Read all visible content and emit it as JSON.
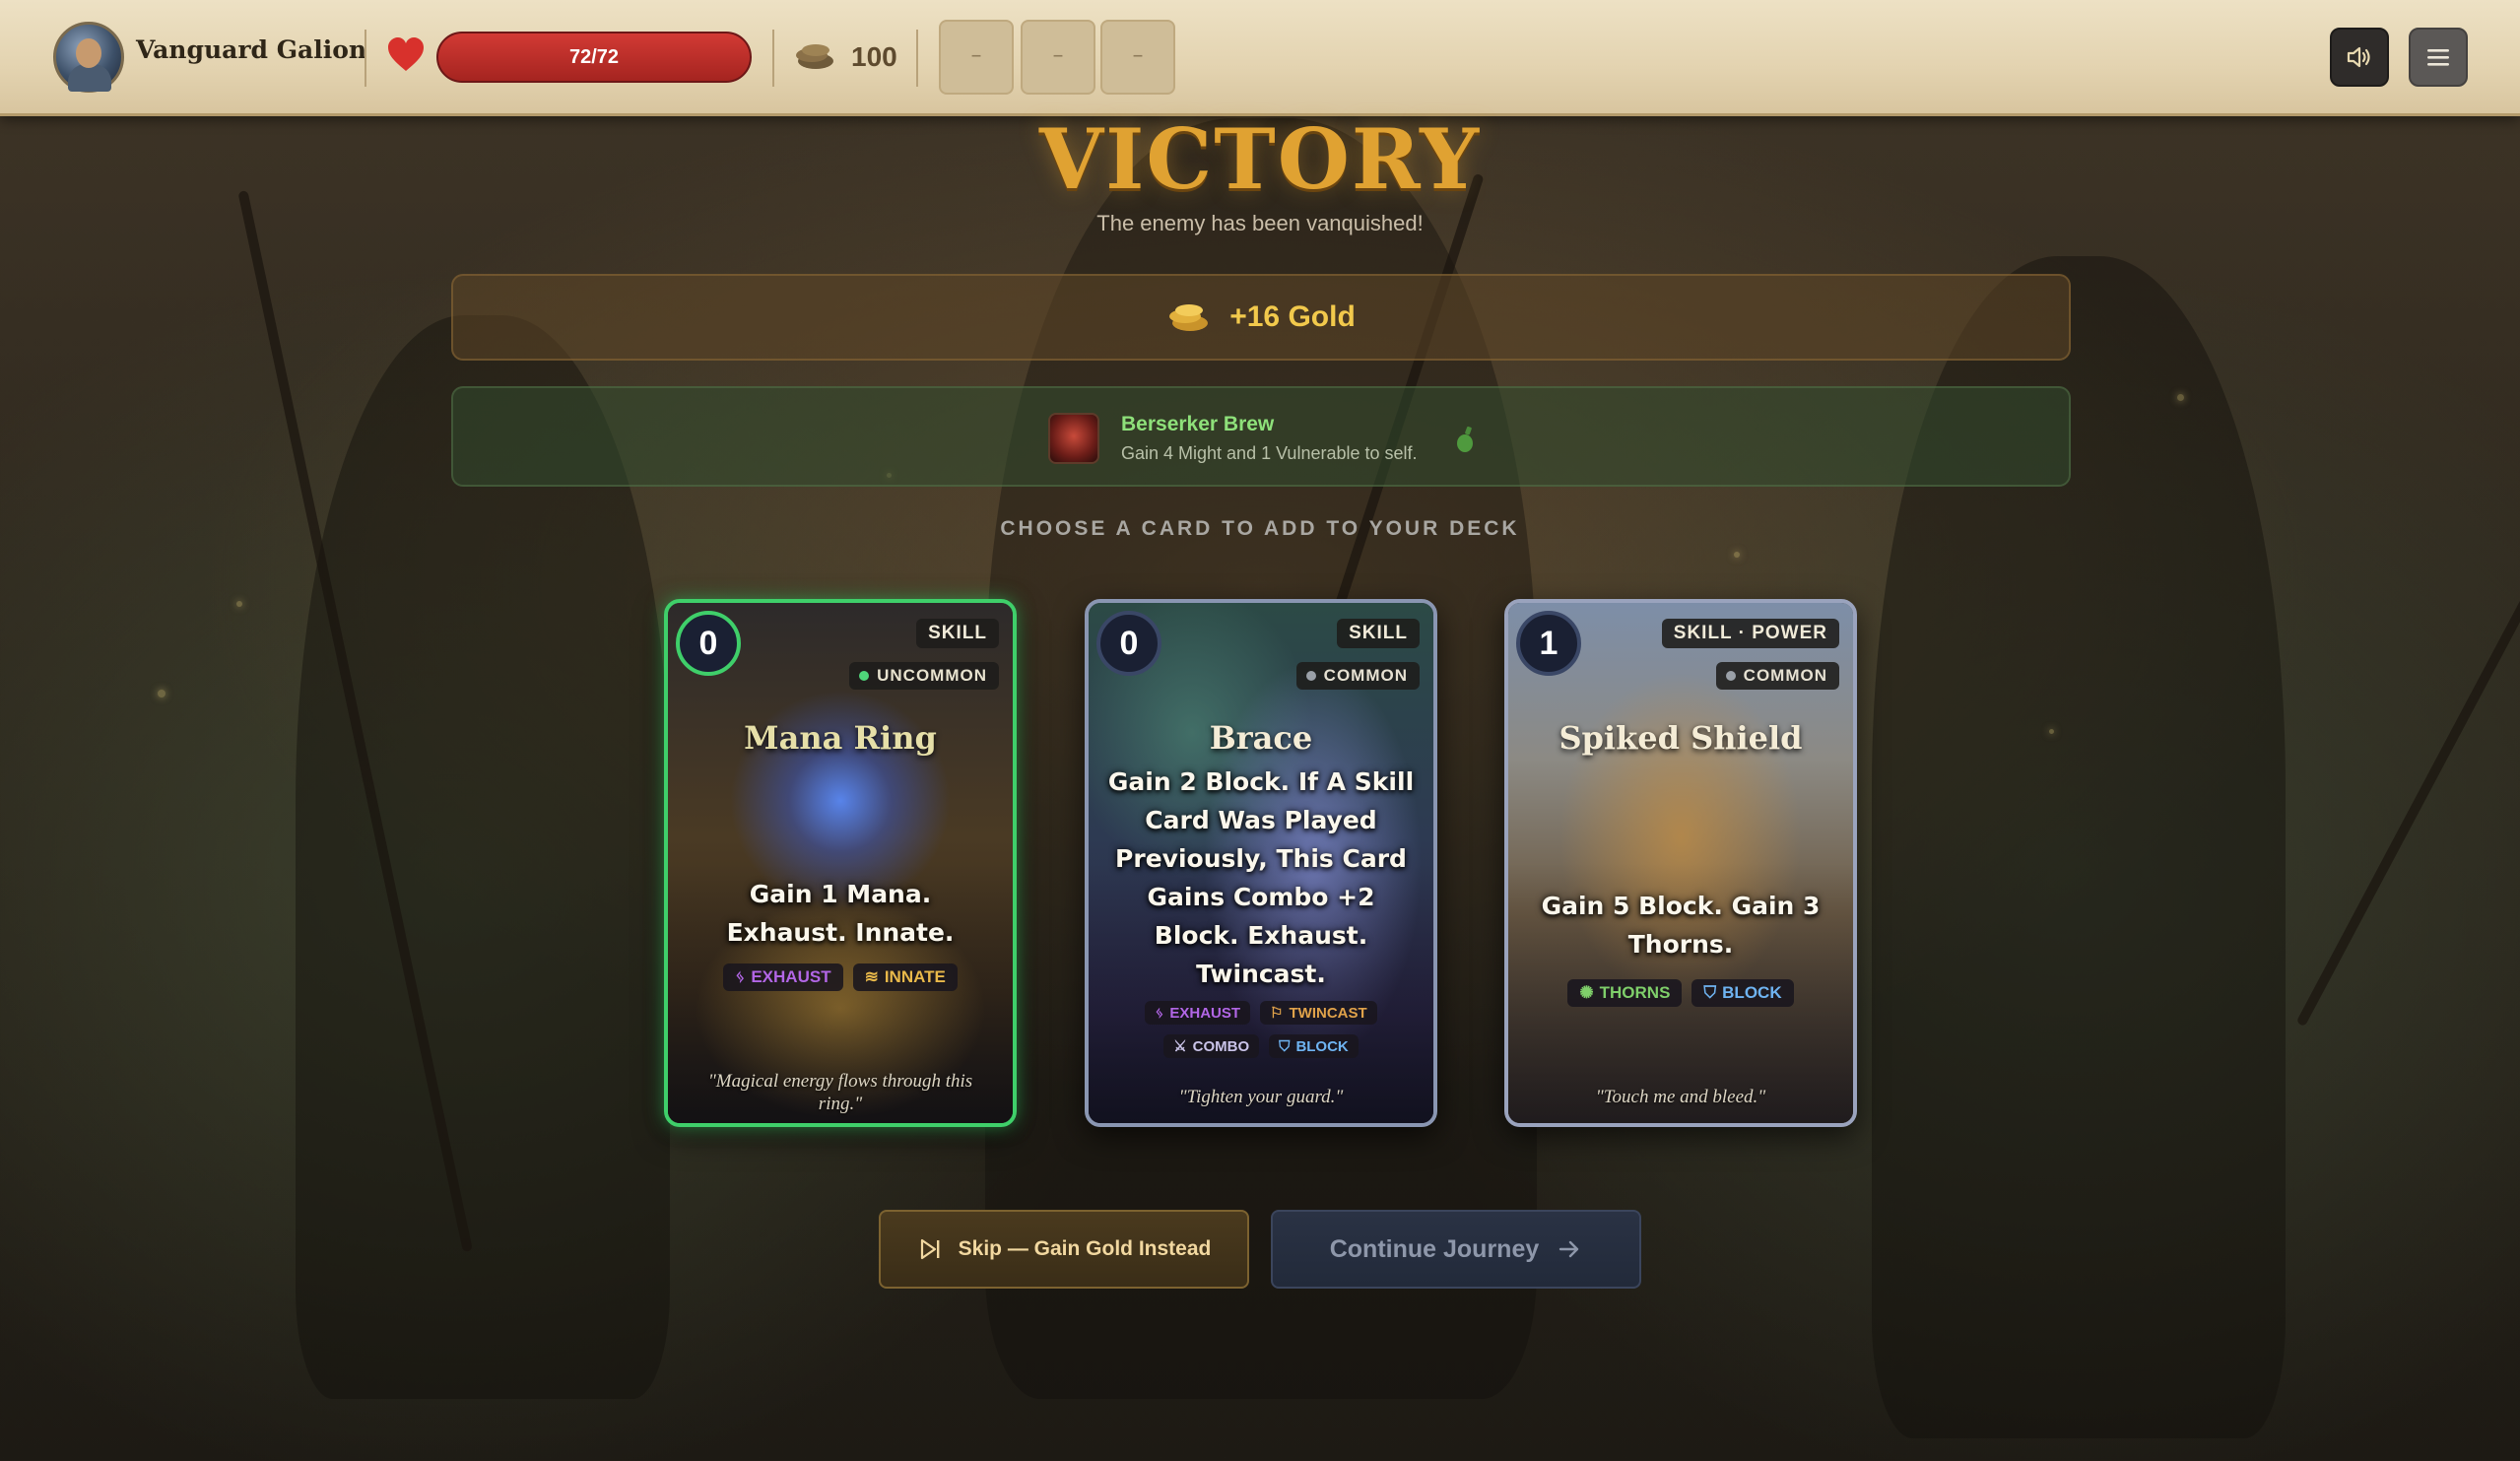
{
  "topbar": {
    "hero_name": "Vanguard Galion",
    "hp": {
      "current": 72,
      "max": 72,
      "text": "72/72"
    },
    "gold": "100",
    "slots": [
      "–",
      "–",
      "–"
    ],
    "icons": {
      "heart": "heart-icon",
      "gold": "coins-icon",
      "sound": "speaker-icon",
      "menu": "hamburger-menu-icon"
    }
  },
  "result": {
    "title": "VICTORY",
    "subtitle": "The enemy has been vanquished!",
    "gold_reward": "+16 Gold",
    "potion": {
      "name": "Berserker Brew",
      "description": "Gain 4 Might and 1 Vulnerable to self."
    },
    "choose_label": "CHOOSE A CARD TO ADD TO YOUR DECK"
  },
  "cards": [
    {
      "cost": "0",
      "type": "SKILL",
      "rarity": "UNCOMMON",
      "name": "Mana Ring",
      "description": "Gain 1 Mana. Exhaust. Innate.",
      "tags": [
        "EXHAUST",
        "INNATE"
      ],
      "flavor": "\"Magical energy flows through this ring.\""
    },
    {
      "cost": "0",
      "type": "SKILL",
      "rarity": "COMMON",
      "name": "Brace",
      "description": "Gain 2 Block. If A Skill Card Was Played Previously, This Card Gains Combo +2 Block. Exhaust. Twincast.",
      "tags": [
        "EXHAUST",
        "TWINCAST",
        "COMBO",
        "BLOCK"
      ],
      "flavor": "\"Tighten your guard.\""
    },
    {
      "cost": "1",
      "type": "SKILL · POWER",
      "rarity": "COMMON",
      "name": "Spiked Shield",
      "description": "Gain 5 Block. Gain 3 Thorns.",
      "tags": [
        "THORNS",
        "BLOCK"
      ],
      "flavor": "\"Touch me and bleed.\""
    }
  ],
  "actions": {
    "skip": "Skip — Gain Gold Instead",
    "continue": "Continue Journey"
  },
  "colors": {
    "title_gold": "#e0a232",
    "selected_card_border": "#3fcf6a",
    "potion_name": "#8ee07a",
    "hp_red": "#d23a34"
  }
}
